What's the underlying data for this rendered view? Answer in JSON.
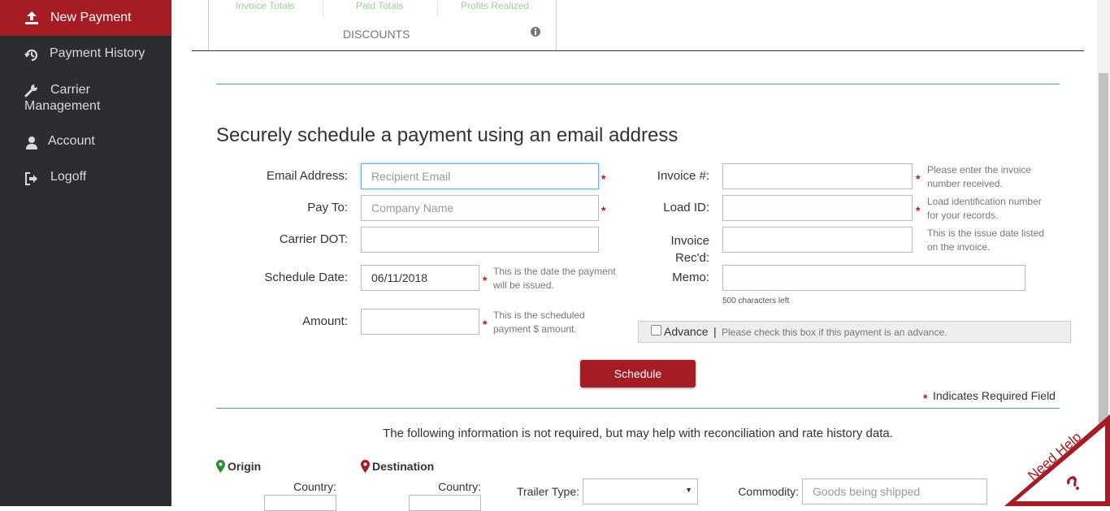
{
  "sidebar": {
    "items": [
      {
        "label": "New Payment",
        "icon": "upload-icon",
        "active": true
      },
      {
        "label": "Payment History",
        "icon": "history-icon"
      },
      {
        "label": "Carrier Management",
        "icon": "wrench-icon"
      },
      {
        "label": "Account",
        "icon": "user-icon"
      },
      {
        "label": "Logoff",
        "icon": "logoff-icon"
      }
    ]
  },
  "tabs": {
    "mini": [
      "Invoice Totals",
      "Paid Totals",
      "Profits Realized"
    ],
    "active_label": "DISCOUNTS"
  },
  "form": {
    "heading": "Securely schedule a payment using an email address",
    "email": {
      "label": "Email Address:",
      "placeholder": "Recipient Email"
    },
    "payto": {
      "label": "Pay To:",
      "placeholder": "Company Name"
    },
    "dot": {
      "label": "Carrier DOT:"
    },
    "schedule": {
      "label": "Schedule Date:",
      "value": "06/11/2018",
      "help1": "This is the date the payment",
      "help2": "will be issued."
    },
    "amount": {
      "label": "Amount:",
      "help1": "This is the scheduled",
      "help2": "payment $ amount."
    },
    "invoice": {
      "label": "Invoice #:",
      "help1": "Please enter the invoice",
      "help2": "number received."
    },
    "load": {
      "label": "Load ID:",
      "help1": "Load identification number",
      "help2": "for your records."
    },
    "recd": {
      "label1": "Invoice",
      "label2": "Rec'd:",
      "help1": "This is the issue date listed",
      "help2": "on the invoice."
    },
    "memo": {
      "label": "Memo:",
      "counter": "500 characters left"
    },
    "advance": {
      "label": "Advance",
      "sep": "|",
      "help": "Please check this box if this payment is an advance."
    },
    "schedule_button": "Schedule",
    "star": "*",
    "required_note": "Indicates Required Field"
  },
  "optional": {
    "intro": "The following information is not required, but may help with reconciliation and rate history data.",
    "origin": "Origin",
    "destination": "Destination",
    "country_label": "Country:",
    "trailer_label": "Trailer Type:",
    "commodity_label": "Commodity:",
    "commodity_placeholder": "Goods being shipped"
  },
  "help_corner": {
    "label": "Need Help",
    "glyph": "?"
  },
  "colors": {
    "sidebar": "#2b2d30",
    "accent": "#a51c24",
    "divider": "#5a9aa5",
    "origin_pin": "#2e8b2e",
    "destination_pin": "#a51c24"
  }
}
